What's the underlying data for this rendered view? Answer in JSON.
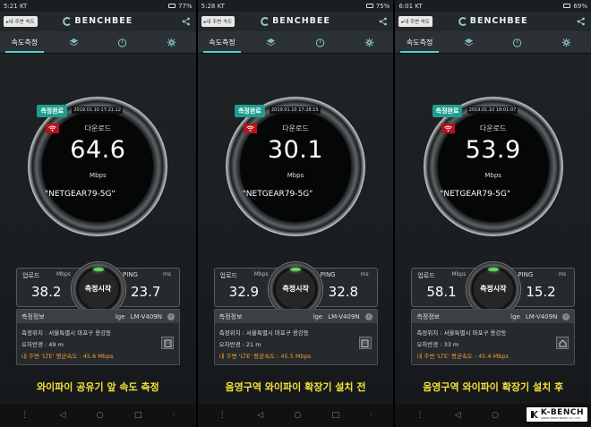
{
  "nav_nearby": "▸내 주변 속도",
  "logo": "BENCHBEE",
  "tabs": {
    "speed": "속도측정"
  },
  "labels": {
    "done": "측정완료",
    "download": "다운로드",
    "unit": "Mbps",
    "upload": "업로드",
    "up_unit": "Mbps",
    "ping": "PING",
    "ping_unit": "ms",
    "start": "측정시작",
    "info": "측정정보",
    "location_label": "측정위치 : ",
    "radius_label": "오차반경 : ",
    "avg_label": "내 주변 'LTE' 평균속도 : "
  },
  "panels": [
    {
      "status_time": "5:21",
      "status_carrier": "KT",
      "battery": "77%",
      "timestamp": "2019.01.10 17:21:12",
      "download": "64.6",
      "ssid": "\"NETGEAR79-5G\"",
      "upload": "38.2",
      "ping": "23.7",
      "network": "lge",
      "device": "LM-V409N",
      "location": "서울특별시 마포구 용강동",
      "radius": "49 m",
      "avg": "45.6 Mbps",
      "caption": "와이파이 공유기 앞 속도 측정"
    },
    {
      "status_time": "5:28",
      "status_carrier": "KT",
      "battery": "75%",
      "timestamp": "2019.01.10 17:28:15",
      "download": "30.1",
      "ssid": "\"NETGEAR79-5G\"",
      "upload": "32.9",
      "ping": "32.8",
      "network": "lge",
      "device": "LM-V409N",
      "location": "서울특별시 마포구 용강동",
      "radius": "21 m",
      "avg": "45.5 Mbps",
      "caption": "음영구역 와이파이 확장기 설치 전"
    },
    {
      "status_time": "6:01",
      "status_carrier": "KT",
      "battery": "69%",
      "timestamp": "2019.01.10 18:01:07",
      "download": "53.9",
      "ssid": "\"NETGEAR79-5G\"",
      "upload": "58.1",
      "ping": "15.2",
      "network": "lge",
      "device": "LM-V409N",
      "location": "서울특별시 마포구 용강동",
      "radius": "33 m",
      "avg": "45.4 Mbps",
      "caption": "음영구역 와이파이 확장기 설치 후"
    }
  ],
  "watermark": {
    "brand": "K-BENCH",
    "sub": "KOREA BENCHMARK CO., LTD."
  },
  "colors": {
    "accent": "#4fd1c9",
    "caption": "#f4e23a",
    "avg": "#f39c34",
    "wifi_badge": "#b5121b"
  }
}
